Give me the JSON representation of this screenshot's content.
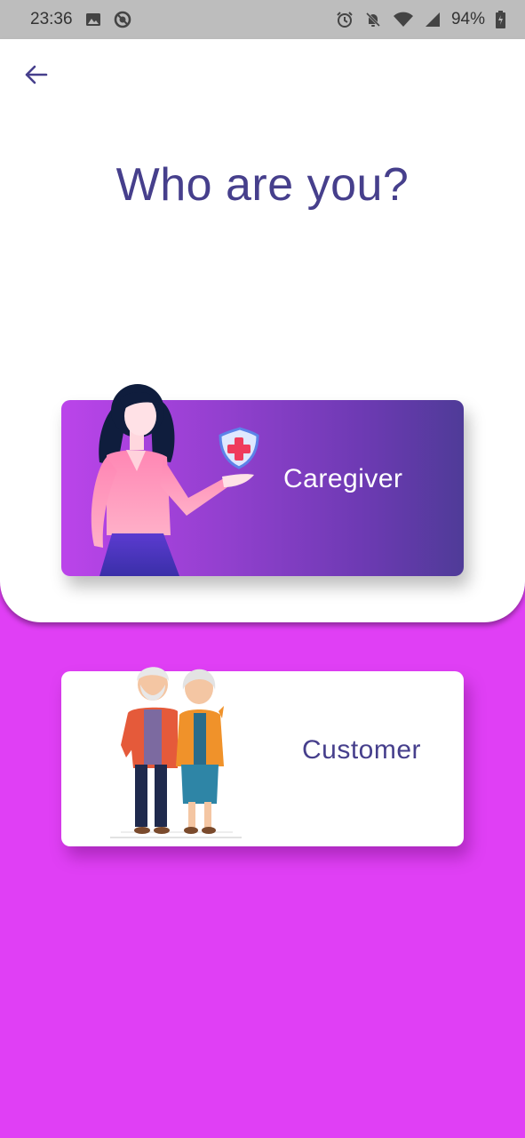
{
  "status_bar": {
    "time": "23:36",
    "battery": "94%",
    "icons_left": [
      "image-icon",
      "sync-off-icon"
    ],
    "icons_right": [
      "alarm-icon",
      "notifications-off-icon",
      "wifi-icon",
      "signal-icon",
      "battery-icon"
    ]
  },
  "header": {
    "back_icon": "arrow-back-icon",
    "title": "Who are you?"
  },
  "roles": [
    {
      "label": "Caregiver",
      "illustration": "woman-with-medical-shield"
    },
    {
      "label": "Customer",
      "illustration": "elderly-couple"
    }
  ],
  "colors": {
    "title": "#463f8c",
    "background": "#e03ff5",
    "caregiver_gradient_start": "#bb44ea",
    "caregiver_gradient_end": "#4f3b98"
  }
}
